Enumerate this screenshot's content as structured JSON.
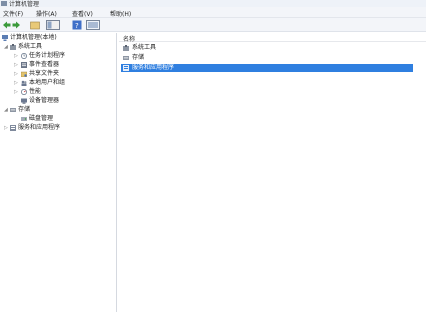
{
  "window": {
    "title": "计算机管理"
  },
  "menu": [
    {
      "label": "文件(F)"
    },
    {
      "label": "操作(A)"
    },
    {
      "label": "查看(V)"
    },
    {
      "label": "帮助(H)"
    }
  ],
  "toolbar": {
    "buttons": [
      {
        "icon": "back-arrow-icon"
      },
      {
        "icon": "forward-arrow-icon"
      },
      {
        "icon": "up-folder-icon"
      },
      {
        "icon": "show-hide-tree-icon"
      },
      {
        "icon": "help-icon"
      },
      {
        "icon": "properties-icon"
      }
    ]
  },
  "tree": {
    "root": "计算机管理(本地)",
    "items": [
      {
        "label": "系统工具",
        "level": 1,
        "expanded": true
      },
      {
        "label": "任务计划程序",
        "level": 2
      },
      {
        "label": "事件查看器",
        "level": 2
      },
      {
        "label": "共享文件夹",
        "level": 2
      },
      {
        "label": "本地用户和组",
        "level": 2
      },
      {
        "label": "性能",
        "level": 2
      },
      {
        "label": "设备管理器",
        "level": 2
      },
      {
        "label": "存储",
        "level": 1,
        "expanded": true
      },
      {
        "label": "磁盘管理",
        "level": 2
      },
      {
        "label": "服务和应用程序",
        "level": 1
      }
    ]
  },
  "list": {
    "header": "名称",
    "items": [
      {
        "label": "系统工具",
        "selected": false
      },
      {
        "label": "存储",
        "selected": false
      },
      {
        "label": "服务和应用程序",
        "selected": true
      }
    ]
  },
  "colors": {
    "selection": "#2f7fe0",
    "icon_blue": "#3f7fcf",
    "icon_gray": "#8d96a3"
  }
}
